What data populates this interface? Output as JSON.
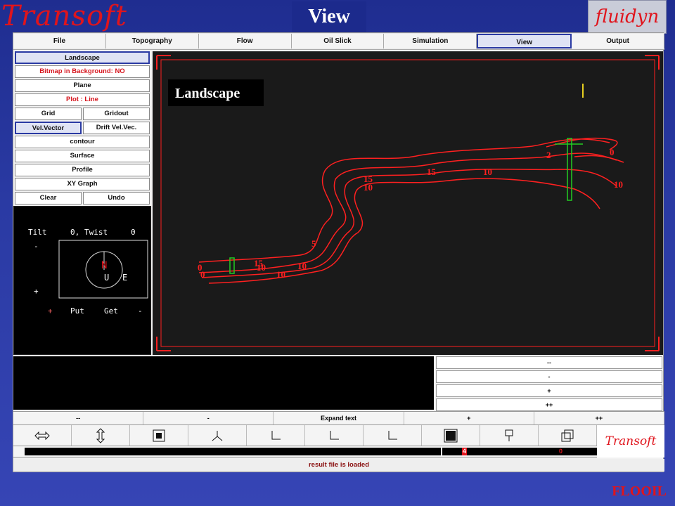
{
  "header": {
    "brand_left": "Transoft",
    "title": "View",
    "brand_right": "fluidyn"
  },
  "menu": [
    "File",
    "Topography",
    "Flow",
    "Oil Slick",
    "Simulation",
    "View",
    "Output"
  ],
  "left_panel": {
    "landscape": "Landscape",
    "bitmap": "Bitmap in Background: NO",
    "plane": "Plane",
    "plot": "Plot : Line",
    "grid": "Grid",
    "gridout": "Gridout",
    "vel_vector": "Vel.Vector",
    "drift": "Drift Vel.Vec.",
    "contour": "contour",
    "surface": "Surface",
    "profile": "Profile",
    "xy_graph": "XY Graph",
    "clear": "Clear",
    "undo": "Undo"
  },
  "orientation": {
    "tilt": "Tilt",
    "tilt_val": "0,",
    "twist": "Twist",
    "twist_val": "0",
    "minus": "-",
    "plus": "+",
    "put": "Put",
    "get": "Get",
    "n": "N",
    "u": "U",
    "e": "E"
  },
  "canvas": {
    "label": "Landscape",
    "contour_labels": [
      "0",
      "10",
      "2",
      "15",
      "10",
      "15",
      "10",
      "5",
      "15",
      "10",
      "10",
      "10",
      "0",
      "0"
    ]
  },
  "side_buttons": [
    "--",
    "-",
    "+",
    "++"
  ],
  "text_bar": [
    "--",
    "-",
    "Expand text",
    "+",
    "++"
  ],
  "progress_nums": [
    "4",
    "0"
  ],
  "bottom_logo": "Transoft",
  "status": "result file is loaded",
  "footer": "FLOOIL",
  "colors": {
    "accent": "#e0141c",
    "background": "#2a3aa3",
    "contour": "#ff2020",
    "marker": "#22cc22"
  }
}
